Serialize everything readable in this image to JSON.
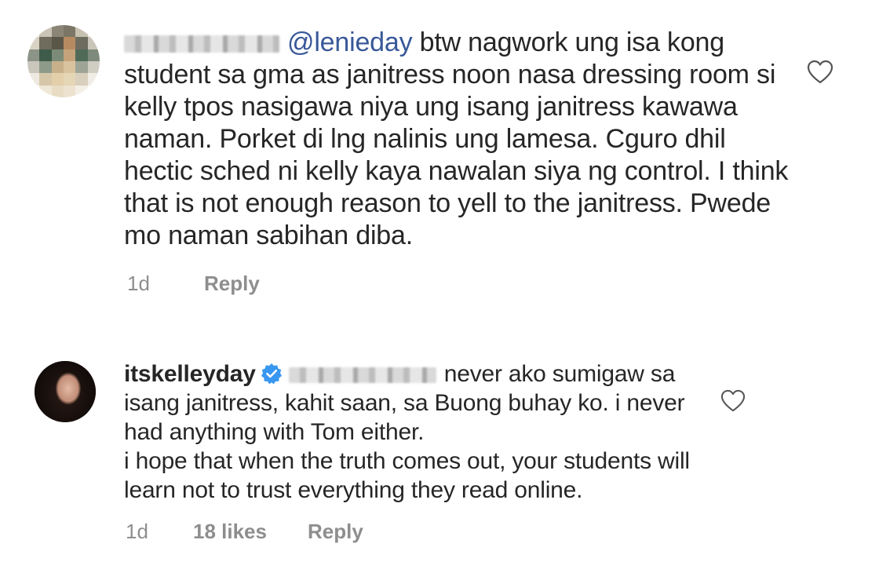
{
  "comments": [
    {
      "mention": "@lenieday",
      "body": " btw nagwork ung isa kong student sa gma as janitress noon nasa dressing room si kelly tpos nasigawa niya ung isang janitress kawawa naman. Porket di lng nalinis ung lamesa. Cguro dhil hectic sched ni kelly kaya nawalan siya ng control. I think that is not enough reason to yell to the janitress. Pwede mo naman sabihan diba.",
      "time": "1d",
      "reply_label": "Reply",
      "icons": {
        "like": "heart-outline-icon"
      }
    },
    {
      "username": "itskelleyday",
      "body": "never ako sumigaw sa isang janitress, kahit saan, sa Buong buhay ko. i never had anything with Tom either.\ni hope that when the truth comes out, your students will learn not to trust everything they read online.",
      "time": "1d",
      "likes": "18 likes",
      "reply_label": "Reply",
      "icons": {
        "verified": "verified-badge-icon",
        "like": "heart-outline-icon"
      }
    }
  ],
  "colors": {
    "text": "#262626",
    "mention": "#385898",
    "meta": "#8e8e8e",
    "verified": "#3897f0"
  }
}
